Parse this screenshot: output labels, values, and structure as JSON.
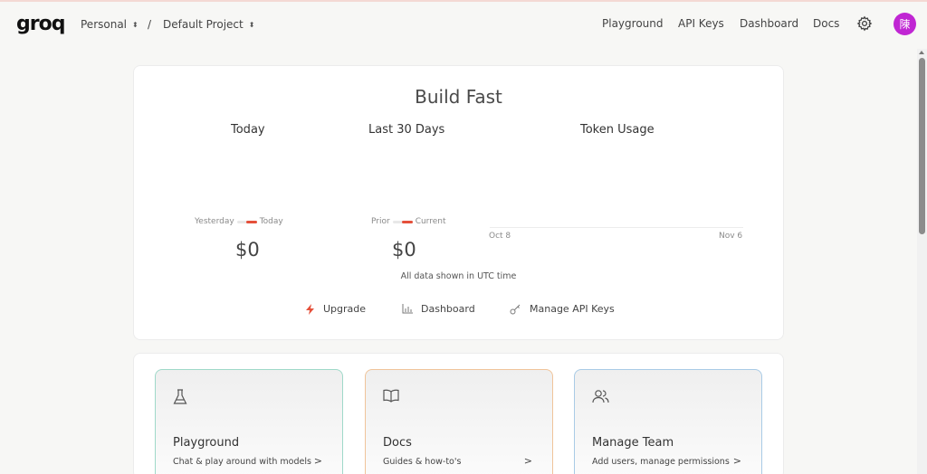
{
  "header": {
    "logo": "groq",
    "org": "Personal",
    "separator": "/",
    "project": "Default Project",
    "nav": [
      "Playground",
      "API Keys",
      "Dashboard",
      "Docs"
    ],
    "avatar_text": "陳",
    "avatar_color": "#c026d3"
  },
  "main": {
    "title": "Build Fast",
    "today": {
      "label": "Today",
      "legend_left": "Yesterday",
      "legend_right": "Today",
      "amount": "$0"
    },
    "month": {
      "label": "Last 30 Days",
      "legend_left": "Prior",
      "legend_right": "Current",
      "amount": "$0"
    },
    "tokens": {
      "label": "Token Usage",
      "start": "Oct 8",
      "end": "Nov 6"
    },
    "utc_note": "All data shown in UTC time",
    "actions": [
      {
        "label": "Upgrade",
        "icon": "lightning-icon"
      },
      {
        "label": "Dashboard",
        "icon": "chart-icon"
      },
      {
        "label": "Manage API Keys",
        "icon": "key-icon"
      }
    ]
  },
  "tiles": [
    {
      "title": "Playground",
      "subtitle": "Chat & play around with models",
      "icon": "flask-icon"
    },
    {
      "title": "Docs",
      "subtitle": "Guides & how-to's",
      "icon": "book-icon"
    },
    {
      "title": "Manage Team",
      "subtitle": "Add users, manage permissions",
      "icon": "users-icon"
    }
  ],
  "colors": {
    "accent": "#e5503a",
    "tile_borders": [
      "#9fd9c9",
      "#f0c49a",
      "#a9cbe6"
    ]
  }
}
